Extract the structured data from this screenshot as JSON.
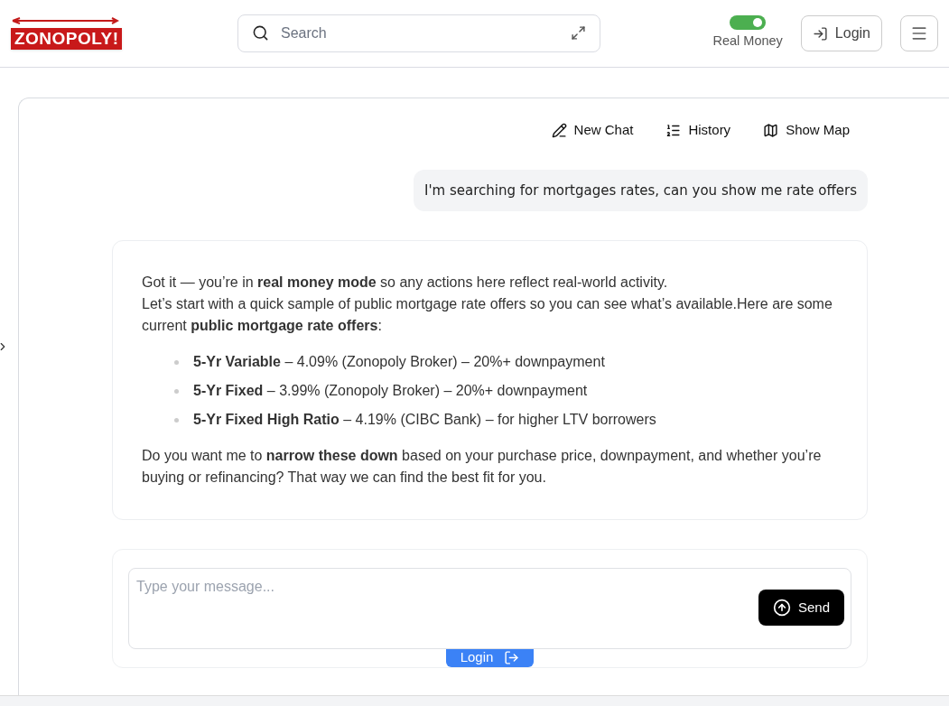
{
  "header": {
    "logo": "ZONOPOLY!",
    "search": {
      "placeholder": "Search"
    },
    "real_money": {
      "label": "Real Money",
      "on": true
    },
    "login": "Login"
  },
  "toolbar": [
    "New Chat",
    "History",
    "Show Map"
  ],
  "messages": [
    {
      "kind": "user",
      "text": "I'm searching for mortgages rates, can you show me rate offers"
    },
    {
      "kind": "assistant",
      "intro": [
        "Got it — you’re in **real money mode** so any actions here reflect real-world activity.",
        "Let’s start with a quick sample of public mortgage rate offers so you can see what’s available.Here are some current **public mortgage rate offers**:"
      ],
      "bullets": [
        "**5-Yr Variable** – 4.09% (Zonopoly Broker) – 20%+ downpayment",
        "**5-Yr Fixed** – 3.99% (Zonopoly Broker) – 20%+ downpayment",
        "**5-Yr Fixed High Ratio** – 4.19% (CIBC Bank) – for higher LTV borrowers"
      ],
      "outro": "Do you want me to **narrow these down** based on your purchase price, downpayment, and whether you’re buying or refinancing? That way we can find the best fit for you."
    }
  ],
  "composer": {
    "placeholder": "Type your message...",
    "send": "Send",
    "login": "Login"
  }
}
